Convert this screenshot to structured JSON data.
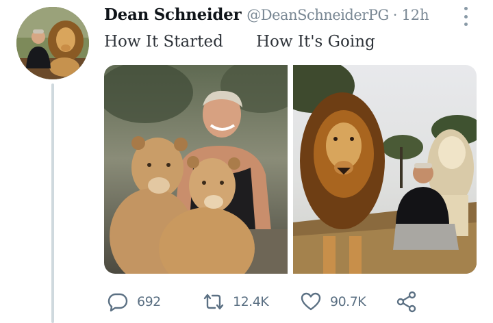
{
  "tweet": {
    "author_name": "Dean Schneider",
    "author_handle": "@DeanSchneiderPG",
    "separator": "·",
    "timestamp": "12h",
    "text_left": "How It Started",
    "text_right": "How It's Going"
  },
  "actions": {
    "reply_count": "692",
    "retweet_count": "12.4K",
    "like_count": "90.7K"
  },
  "icons": {
    "more": "more-vertical-icon",
    "reply": "speech-bubble-icon",
    "retweet": "retweet-icon",
    "like": "heart-icon",
    "share": "share-icon"
  },
  "colors": {
    "name": "#0f1419",
    "muted": "#7a8894",
    "icon": "#5b7083",
    "thread_line": "#cfd9de"
  }
}
